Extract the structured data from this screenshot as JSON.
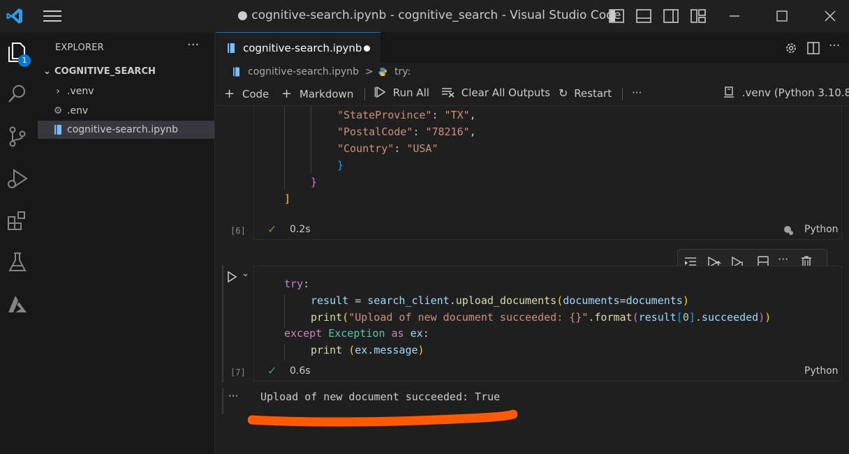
{
  "window": {
    "title": "● cognitive-search.ipynb - cognitive_search - Visual Studio Code"
  },
  "activity": {
    "explorer_badge": "1",
    "icons": [
      "explorer-icon",
      "search-icon",
      "source-control-icon",
      "run-debug-icon",
      "extensions-icon",
      "testing-icon",
      "azure-icon"
    ]
  },
  "sidebar": {
    "title": "EXPLORER",
    "more": "···",
    "folder": "COGNITIVE_SEARCH",
    "items": [
      {
        "label": ".venv",
        "icon": "chevron-right-icon"
      },
      {
        "label": ".env",
        "icon": "gear-icon"
      },
      {
        "label": "cognitive-search.ipynb",
        "icon": "notebook-icon",
        "selected": true
      }
    ]
  },
  "tab": {
    "label": "cognitive-search.ipynb",
    "modified": true
  },
  "breadcrumb": {
    "file": "cognitive-search.ipynb",
    "separator": ">",
    "symbol": "try:"
  },
  "toolbar": {
    "code": "Code",
    "markdown": "Markdown",
    "run_all": "Run All",
    "clear_all": "Clear All Outputs",
    "restart": "Restart",
    "more": "···",
    "kernel": ".venv (Python 3.10.8)"
  },
  "cell6": {
    "lines": {
      "l1k": "\"StateProvince\"",
      "l1v": "\"TX\"",
      "l2k": "\"PostalCode\"",
      "l2v": "\"78216\"",
      "l3k": "\"Country\"",
      "l3v": "\"USA\""
    },
    "exec": "[6]",
    "duration": "0.2s",
    "language": "Python"
  },
  "cell7": {
    "exec": "[7]",
    "duration": "0.6s",
    "language": "Python",
    "code": {
      "try": "try",
      "result": "result",
      "search_client": "search_client",
      "upload": "upload_documents",
      "documents": "documents",
      "print": "print",
      "fmt_str": "\"Upload of new document succeeded: {}\"",
      "format": "format",
      "idx": "0",
      "succeeded": "succeeded",
      "except": "except",
      "exception": "Exception",
      "as": "as",
      "ex": "ex",
      "message": "message"
    }
  },
  "output": {
    "text": "Upload of new document succeeded: True",
    "more": "···"
  },
  "colors": {
    "accent": "#0078d4",
    "annotation": "#ff5a00",
    "success": "#4ea14e"
  }
}
